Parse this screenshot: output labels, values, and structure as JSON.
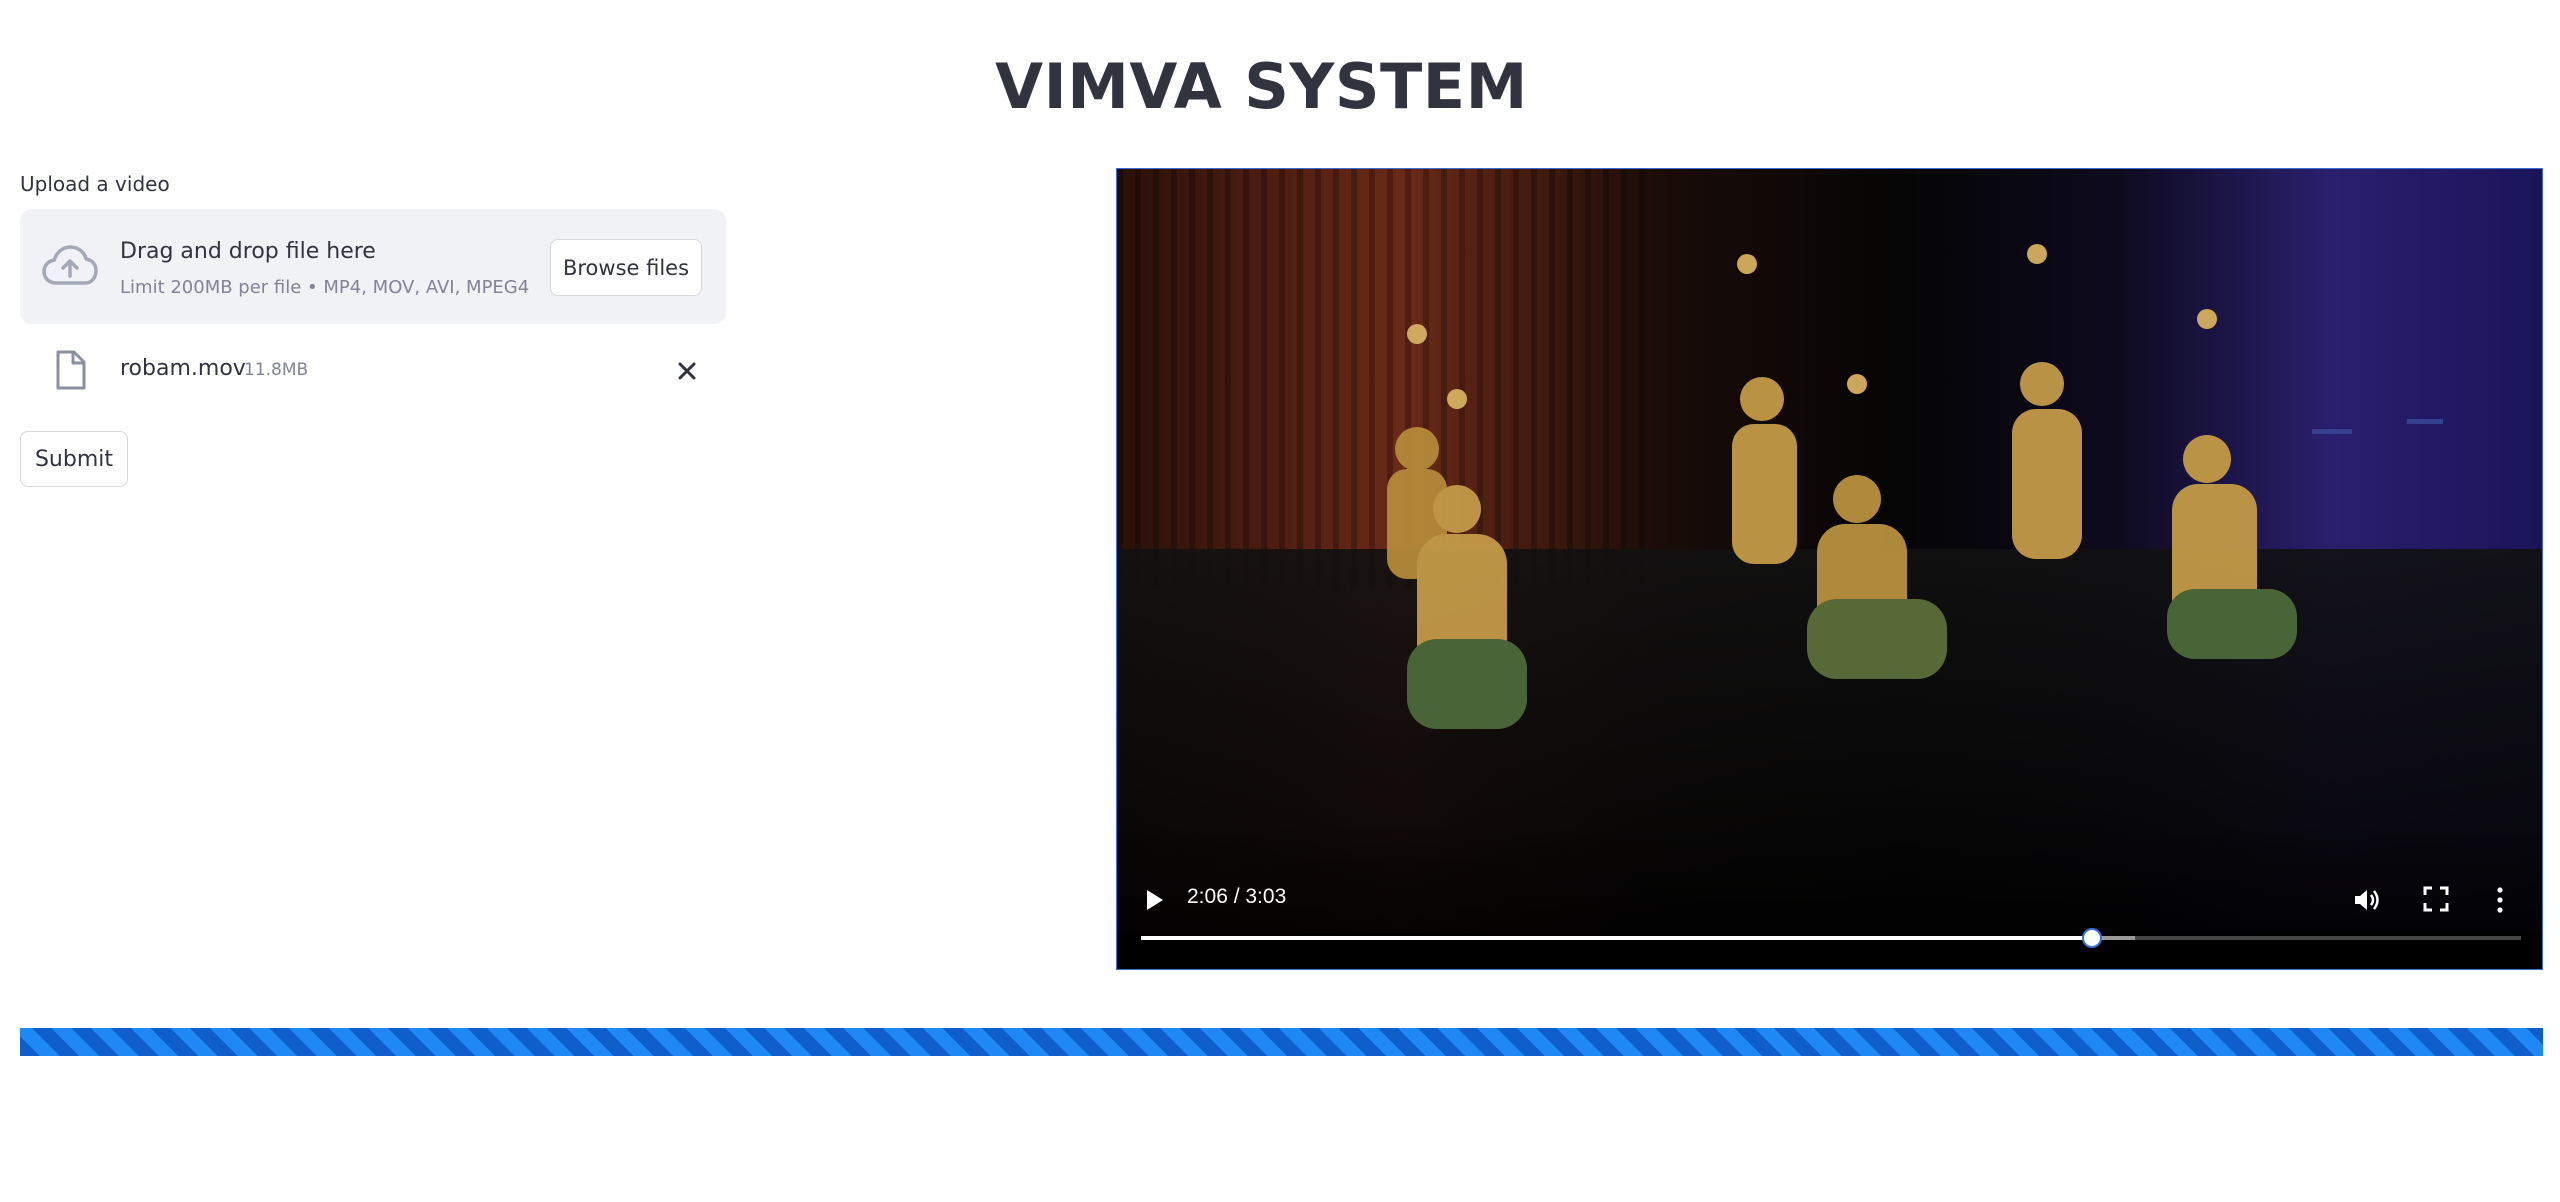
{
  "page": {
    "title": "VIMVA SYSTEM"
  },
  "uploader": {
    "label": "Upload a video",
    "dropzone_title": "Drag and drop file here",
    "dropzone_limit": "Limit 200MB per file • MP4, MOV, AVI, MPEG4",
    "browse_label": "Browse files",
    "icon": "cloud-upload-icon"
  },
  "uploaded_file": {
    "name": "robam.mov",
    "size": "11.8MB",
    "icon": "file-icon",
    "remove_icon": "close-icon"
  },
  "actions": {
    "submit_label": "Submit"
  },
  "video": {
    "time_display": "2:06 / 3:03",
    "played_fraction": 0.689,
    "buffered_fraction": 0.72,
    "controls": [
      "play-icon",
      "volume-icon",
      "fullscreen-icon",
      "more-options-icon"
    ]
  },
  "status": {
    "progress_bar": "running",
    "colors": {
      "stripe_dark": "#0F5ECB",
      "stripe_light": "#1E88F5"
    }
  }
}
